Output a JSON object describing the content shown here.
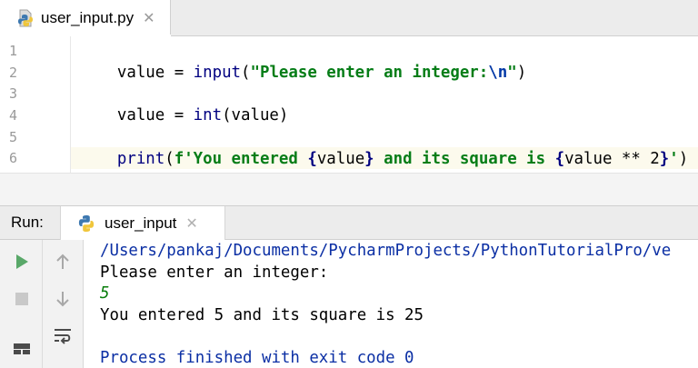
{
  "editor_tab": {
    "filename": "user_input.py",
    "close_glyph": "✕",
    "icon": "python-file-icon"
  },
  "editor": {
    "line_numbers": [
      "1",
      "2",
      "3",
      "4",
      "5",
      "6"
    ],
    "current_line": 6,
    "lines": {
      "l1": {
        "a": "value = ",
        "fn": "input",
        "b": "(",
        "s1": "\"Please enter an integer:",
        "esc": "\\n",
        "s2": "\"",
        "c": ")"
      },
      "l3": {
        "a": "value = ",
        "fn": "int",
        "b": "(value)"
      },
      "l5": {
        "fn": "print",
        "b": "(",
        "s1": "f'You entered ",
        "br1": "{",
        "v1": "value",
        "br2": "}",
        "s2": " and its square is ",
        "br3": "{",
        "v2": "value ** 2",
        "br4": "}",
        "s3": "'",
        "c": ")"
      }
    }
  },
  "run_panel": {
    "label": "Run:",
    "tab_name": "user_input",
    "close_glyph": "✕",
    "toolbar": [
      "run-icon",
      "stop-icon",
      "up-icon",
      "down-icon",
      "layout-icon",
      "soft-wrap-icon"
    ]
  },
  "console": {
    "path": "/Users/pankaj/Documents/PycharmProjects/PythonTutorialPro/ve",
    "prompt": "Please enter an integer:",
    "user_input": "5",
    "result": "You entered 5 and its square is 25",
    "exit": "Process finished with exit code 0"
  },
  "colors": {
    "keyword_fn": "#000080",
    "string": "#067d17",
    "escape": "#0037a6",
    "console_path": "#0b2fa4",
    "console_input": "#087d0b",
    "run_green": "#59a869"
  }
}
